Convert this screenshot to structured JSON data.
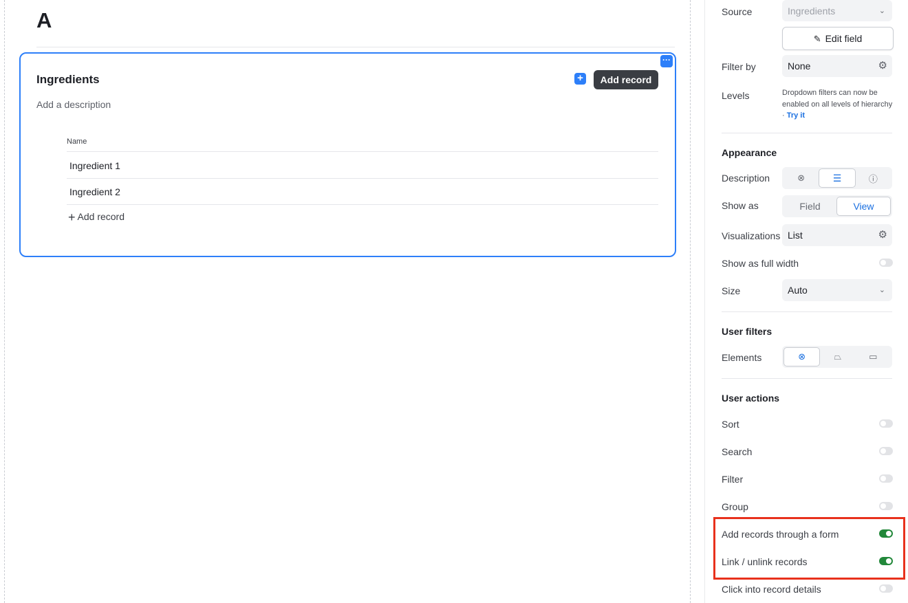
{
  "page": {
    "title": "A"
  },
  "element": {
    "title": "Ingredients",
    "description_placeholder": "Add a description",
    "menu_icon": "ellipsis-icon",
    "add_button_label": "Add record",
    "column_header": "Name",
    "rows": [
      "Ingredient 1",
      "Ingredient 2"
    ],
    "add_row_label": "Add record"
  },
  "sidebar": {
    "source_label": "Source",
    "source_value": "Ingredients",
    "edit_field_label": "Edit field",
    "filter_by_label": "Filter by",
    "filter_by_value": "None",
    "levels_label": "Levels",
    "levels_text": "Dropdown filters can now be enabled on all levels of hierarchy ·",
    "levels_link": "Try it",
    "appearance_heading": "Appearance",
    "description_label": "Description",
    "show_as_label": "Show as",
    "show_as_options": [
      "Field",
      "View"
    ],
    "show_as_selected": "View",
    "visualizations_label": "Visualizations",
    "visualizations_value": "List",
    "full_width_label": "Show as full width",
    "size_label": "Size",
    "size_value": "Auto",
    "user_filters_heading": "User filters",
    "elements_label": "Elements",
    "user_actions_heading": "User actions",
    "actions": [
      {
        "label": "Sort",
        "on": false
      },
      {
        "label": "Search",
        "on": false
      },
      {
        "label": "Filter",
        "on": false
      },
      {
        "label": "Group",
        "on": false
      },
      {
        "label": "Add records through a form",
        "on": true
      },
      {
        "label": "Link / unlink records",
        "on": true
      },
      {
        "label": "Click into record details",
        "on": false
      }
    ]
  },
  "colors": {
    "accent": "#2d7ff9",
    "toggle_on": "#22883a",
    "highlight": "#e8311c",
    "dark_button": "#3a3d43"
  }
}
